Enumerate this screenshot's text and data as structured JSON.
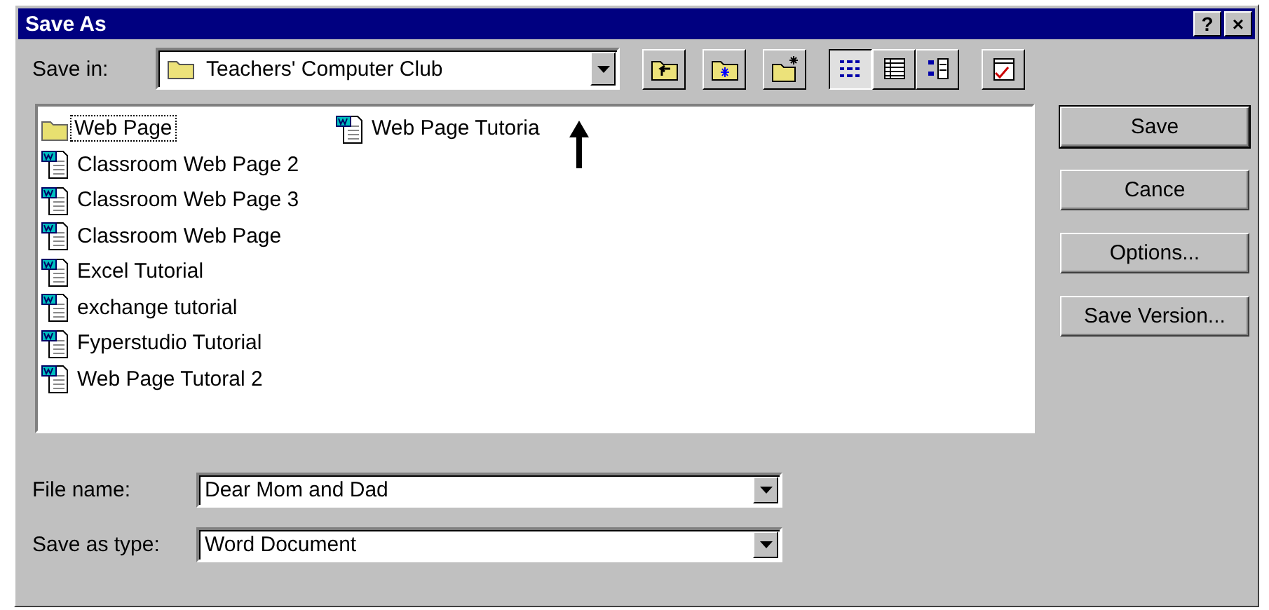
{
  "window": {
    "title": "Save As",
    "help": "?",
    "close": "×"
  },
  "save_in": {
    "label": "Save in:",
    "value": "Teachers' Computer Club"
  },
  "toolbar": [
    {
      "kind": "up"
    },
    {
      "kind": "favorites"
    },
    {
      "kind": "new-folder"
    },
    {
      "kind": "list",
      "selected": true
    },
    {
      "kind": "details",
      "selected": false
    },
    {
      "kind": "properties",
      "selected": false
    },
    {
      "kind": "commands"
    }
  ],
  "files": [
    {
      "kind": "folder",
      "name": "Web Page",
      "selected": true
    },
    {
      "kind": "document",
      "name": "Classroom Web Page 2",
      "selected": false
    },
    {
      "kind": "document",
      "name": "Classroom Web Page 3",
      "selected": false
    },
    {
      "kind": "document",
      "name": "Classroom Web Page",
      "selected": false
    },
    {
      "kind": "document",
      "name": "Excel Tutorial",
      "selected": false
    },
    {
      "kind": "document",
      "name": "exchange tutorial",
      "selected": false
    },
    {
      "kind": "document",
      "name": "Fyperstudio Tutorial",
      "selected": false
    },
    {
      "kind": "document",
      "name": "Web Page Tutoral 2",
      "selected": false
    },
    {
      "kind": "document",
      "name": "Web Page Tutoria",
      "selected": false
    }
  ],
  "buttons": [
    {
      "label": "Save",
      "default": true
    },
    {
      "label": "Cance",
      "default": false
    },
    {
      "label": "Options...",
      "default": false
    },
    {
      "label": "Save Version...",
      "default": false
    }
  ],
  "file_name": {
    "label": "File name:",
    "value": "Dear Mom and Dad"
  },
  "save_as_type": {
    "label": "Save as type:",
    "value": "Word Document"
  }
}
